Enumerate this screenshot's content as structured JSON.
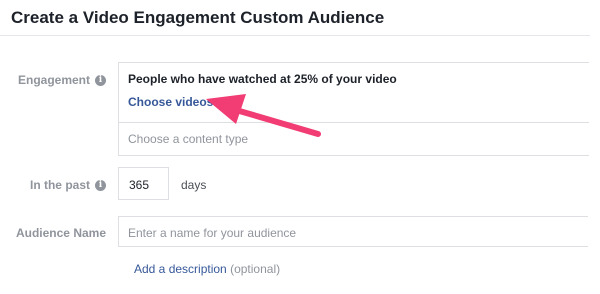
{
  "dialog": {
    "title": "Create a Video Engagement Custom Audience"
  },
  "engagement": {
    "label": "Engagement",
    "selected_option": "People who have watched at 25% of your video",
    "choose_videos_label": "Choose videos..",
    "content_type_placeholder": "Choose a content type"
  },
  "in_the_past": {
    "label": "In the past",
    "value": "365",
    "unit": "days"
  },
  "audience_name": {
    "label": "Audience Name",
    "placeholder": "Enter a name for your audience"
  },
  "description": {
    "link_label": "Add a description",
    "optional_note": "(optional)"
  },
  "icons": {
    "info": "info-icon",
    "arrow": "annotation-arrow"
  },
  "colors": {
    "link": "#365899",
    "label": "#90949c",
    "arrow": "#f23c74"
  }
}
